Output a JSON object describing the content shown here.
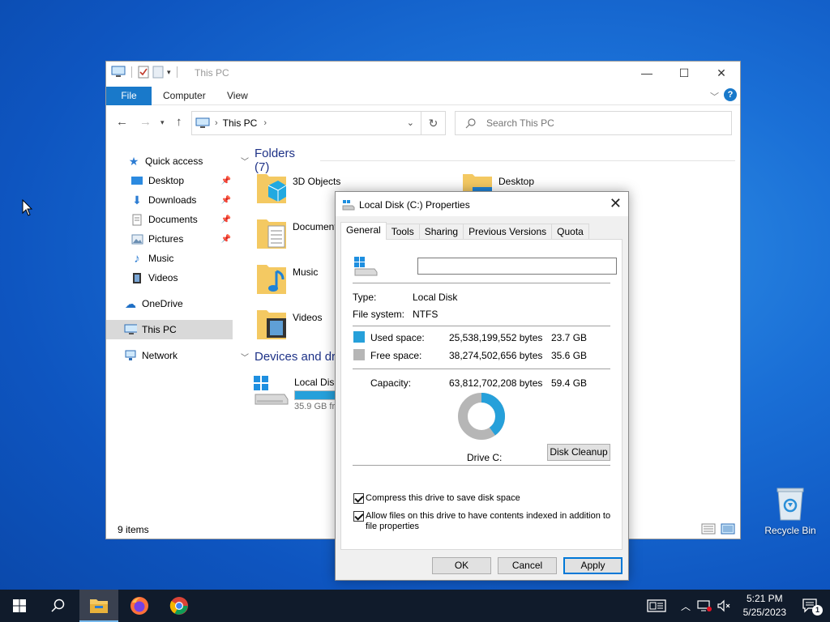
{
  "desktop": {
    "recycle_bin_label": "Recycle Bin"
  },
  "explorer": {
    "title": "This PC",
    "ribbon_tabs": {
      "file": "File",
      "computer": "Computer",
      "view": "View"
    },
    "address": "This PC",
    "search_placeholder": "Search This PC",
    "nav": {
      "quick_access": "Quick access",
      "desktop": "Desktop",
      "downloads": "Downloads",
      "documents": "Documents",
      "pictures": "Pictures",
      "music": "Music",
      "videos": "Videos",
      "onedrive": "OneDrive",
      "this_pc": "This PC",
      "network": "Network"
    },
    "folders_header": "Folders (7)",
    "folders": {
      "objects3d": "3D Objects",
      "desktop": "Desktop",
      "documents": "Documents",
      "music": "Music",
      "videos": "Videos"
    },
    "devices_header": "Devices and drives (1)",
    "drive_name": "Local Disk (C:)",
    "drive_free": "35.9 GB free of 59.4 GB",
    "drive_used_fraction": 0.4,
    "status_count": "9 items"
  },
  "dialog": {
    "title": "Local Disk (C:) Properties",
    "tabs": {
      "general": "General",
      "tools": "Tools",
      "sharing": "Sharing",
      "previous_versions": "Previous Versions",
      "quota": "Quota"
    },
    "name_value": "",
    "type_label": "Type:",
    "type_value": "Local Disk",
    "fs_label": "File system:",
    "fs_value": "NTFS",
    "used_label": "Used space:",
    "used_bytes": "25,538,199,552 bytes",
    "used_gb": "23.7 GB",
    "free_label": "Free space:",
    "free_bytes": "38,274,502,656 bytes",
    "free_gb": "35.6 GB",
    "capacity_label": "Capacity:",
    "capacity_bytes": "63,812,702,208 bytes",
    "capacity_gb": "59.4 GB",
    "drive_label": "Drive C:",
    "disk_cleanup": "Disk Cleanup",
    "compress_label": "Compress this drive to save disk space",
    "index_label_1": "Allow files on this drive to have contents indexed in addition to",
    "index_label_2": "file properties",
    "ok": "OK",
    "cancel": "Cancel",
    "apply": "Apply",
    "used_fraction": 0.4,
    "colors": {
      "used": "#26a0da",
      "free": "#b6b6b6"
    }
  },
  "taskbar": {
    "time": "5:21 PM",
    "date": "5/25/2023",
    "notification_count": "1"
  }
}
